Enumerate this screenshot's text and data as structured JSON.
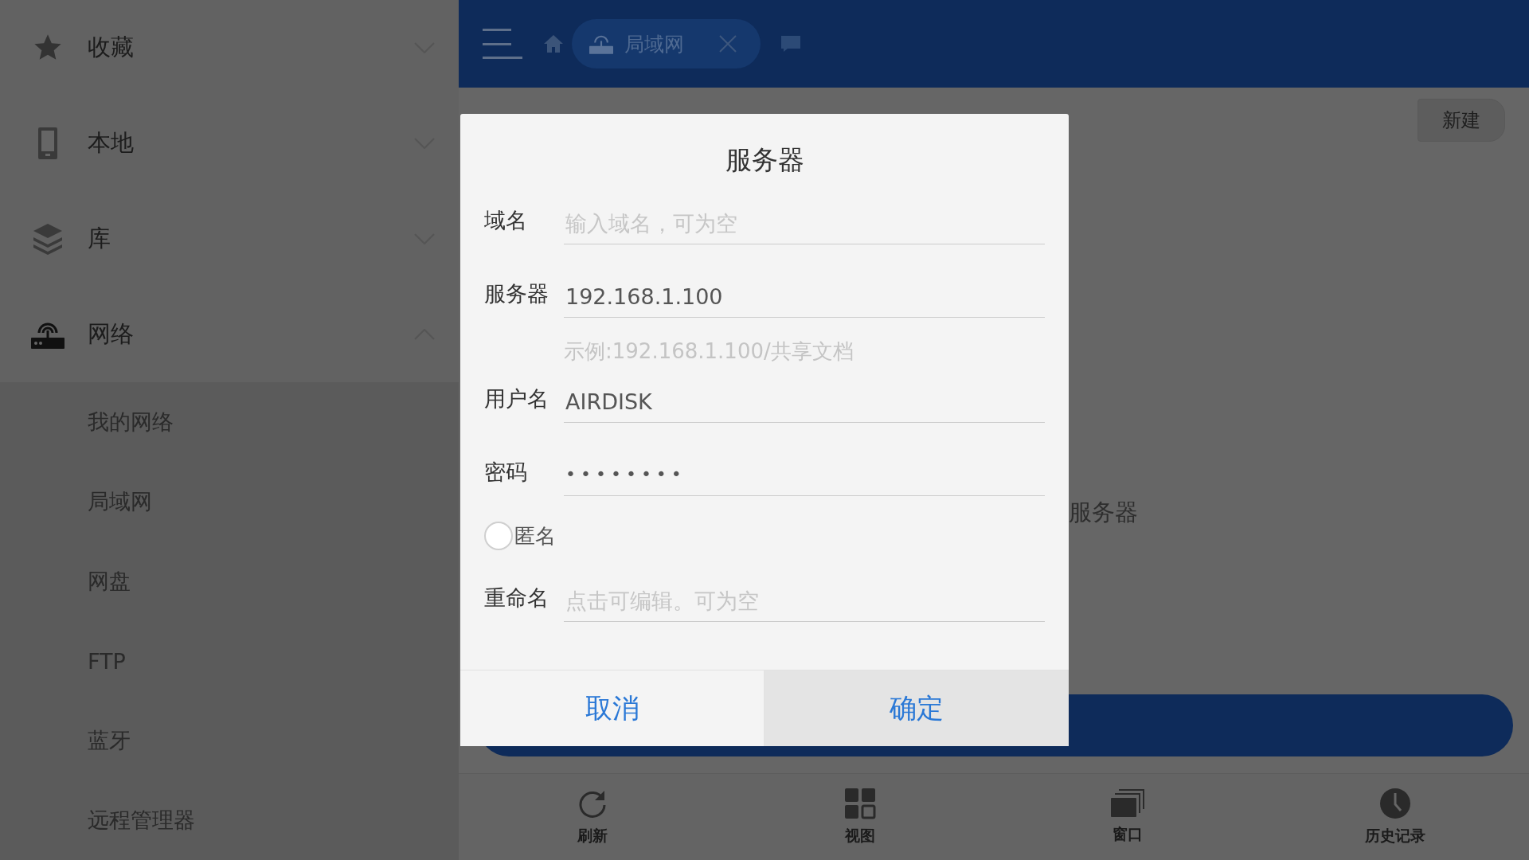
{
  "sidebar": {
    "sections": [
      {
        "label": "收藏",
        "kind": "star",
        "expanded": false
      },
      {
        "label": "本地",
        "kind": "phone",
        "expanded": false
      },
      {
        "label": "库",
        "kind": "layers",
        "expanded": false
      },
      {
        "label": "网络",
        "kind": "router",
        "expanded": true,
        "children": [
          {
            "label": "我的网络"
          },
          {
            "label": "局域网"
          },
          {
            "label": "网盘"
          },
          {
            "label": "FTP"
          },
          {
            "label": "蓝牙"
          },
          {
            "label": "远程管理器"
          }
        ]
      }
    ]
  },
  "toolbar": {
    "tab": {
      "label": "局域网"
    }
  },
  "content": {
    "new_button": "新建",
    "hint_fragment": "服务器"
  },
  "dialog": {
    "title": "服务器",
    "fields": [
      {
        "kind": "input",
        "label": "域名",
        "placeholder": "输入域名，可为空"
      },
      {
        "kind": "input",
        "label": "服务器",
        "value": "192.168.1.100"
      },
      {
        "kind": "hint",
        "text": "示例:192.168.1.100/共享文档"
      },
      {
        "kind": "input",
        "label": "用户名",
        "value": "AIRDISK"
      },
      {
        "kind": "password",
        "label": "密码",
        "value": "••••••••"
      },
      {
        "kind": "radio",
        "label": "匿名",
        "checked": false
      },
      {
        "kind": "input",
        "label": "重命名",
        "placeholder": "点击可编辑。可为空"
      }
    ],
    "buttons": [
      {
        "label": "取消",
        "selected": false
      },
      {
        "label": "确定",
        "selected": true
      }
    ]
  },
  "bottom_bar": [
    {
      "label": "刷新",
      "kind": "refresh"
    },
    {
      "label": "视图",
      "kind": "grid"
    },
    {
      "label": "窗口",
      "kind": "windows"
    },
    {
      "label": "历史记录",
      "kind": "clock"
    }
  ]
}
